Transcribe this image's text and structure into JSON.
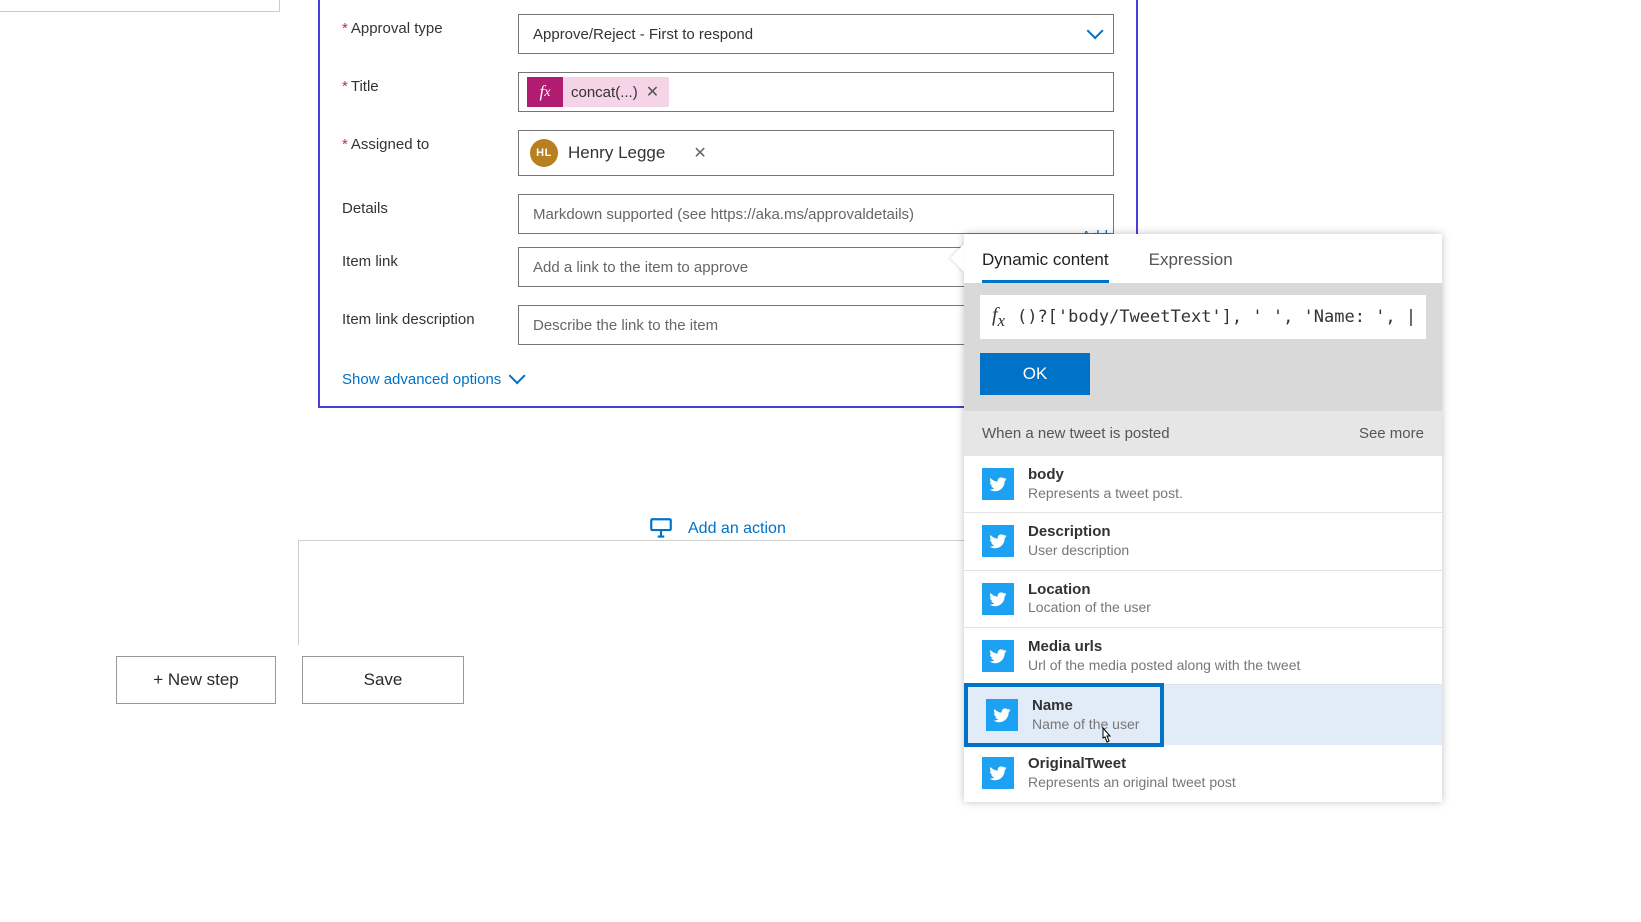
{
  "card": {
    "fields": {
      "approval_type": {
        "label": "Approval type",
        "value": "Approve/Reject - First to respond"
      },
      "title": {
        "label": "Title",
        "expr_text": "concat(...)"
      },
      "assigned_to": {
        "label": "Assigned to",
        "person_initials": "HL",
        "person_name": "Henry Legge"
      },
      "details": {
        "label": "Details",
        "placeholder": "Markdown supported (see https://aka.ms/approvaldetails)"
      },
      "item_link": {
        "label": "Item link",
        "placeholder": "Add a link to the item to approve"
      },
      "item_link_desc": {
        "label": "Item link description",
        "placeholder": "Describe the link to the item"
      }
    },
    "add_link": "Add",
    "advanced_toggle": "Show advanced options"
  },
  "add_action": "Add an action",
  "footer": {
    "new_step": "+ New step",
    "save": "Save"
  },
  "popover": {
    "tabs": {
      "dynamic": "Dynamic content",
      "expression": "Expression"
    },
    "fx_text": "()?['body/TweetText'], ' ', 'Name: ', |",
    "ok": "OK",
    "section": {
      "title": "When a new tweet is posted",
      "see_more": "See more"
    },
    "items": [
      {
        "title": "body",
        "desc": "Represents a tweet post."
      },
      {
        "title": "Description",
        "desc": "User description"
      },
      {
        "title": "Location",
        "desc": "Location of the user"
      },
      {
        "title": "Media urls",
        "desc": "Url of the media posted along with the tweet"
      },
      {
        "title": "Name",
        "desc": "Name of the user"
      },
      {
        "title": "OriginalTweet",
        "desc": "Represents an original tweet post"
      }
    ]
  }
}
